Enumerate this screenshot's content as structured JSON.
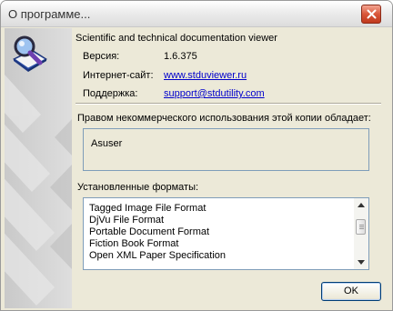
{
  "window": {
    "title": "О программе..."
  },
  "about": {
    "app_name": "Scientific and technical documentation viewer",
    "version_label": "Версия:",
    "version_value": "1.6.375",
    "website_label": "Интернет-сайт:",
    "website_value": "www.stduviewer.ru",
    "support_label": "Поддержка:",
    "support_value": "support@stdutility.com"
  },
  "license": {
    "caption": "Правом некоммерческого использования этой копии обладает:",
    "owner": "Asuser"
  },
  "formats": {
    "caption": "Установленные форматы:",
    "items": [
      "Tagged Image File Format",
      "DjVu File Format",
      "Portable Document Format",
      "Fiction Book Format",
      "Open XML Paper Specification"
    ]
  },
  "buttons": {
    "ok": "OK"
  },
  "icons": {
    "close": "close-icon",
    "app": "magnifier-book-icon"
  }
}
